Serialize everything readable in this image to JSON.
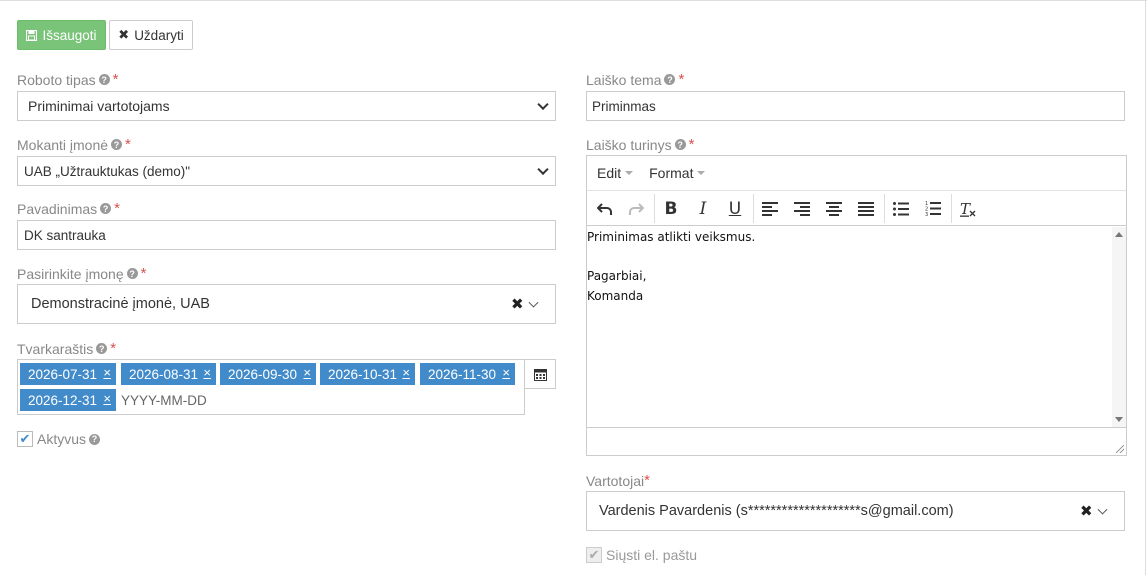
{
  "toolbar": {
    "save_label": "Išsaugoti",
    "close_label": "Uždaryti"
  },
  "form": {
    "robot_type": {
      "label": "Roboto tipas",
      "value": "Priminimai vartotojams"
    },
    "company": {
      "label": "Mokanti įmonė",
      "value": "UAB „Užtrauktukas (demo)\""
    },
    "name": {
      "label": "Pavadinimas",
      "value": "DK santrauka"
    },
    "select_company": {
      "label": "Pasirinkite įmonę",
      "value": "Demonstracinė įmonė, UAB"
    },
    "schedule": {
      "label": "Tvarkaraštis",
      "dates": [
        "2026-07-31",
        "2026-08-31",
        "2026-09-30",
        "2026-10-31",
        "2026-11-30",
        "2026-12-31"
      ],
      "remove_glyph": "×",
      "placeholder": "YYYY-MM-DD"
    },
    "active": {
      "label": "Aktyvus",
      "checked": true
    },
    "subject": {
      "label": "Laiško tema",
      "value": "Priminmas"
    },
    "body": {
      "label": "Laiško turinys",
      "menus": [
        "Edit",
        "Format"
      ],
      "lines": [
        "Priminimas atlikti veiksmus.",
        "",
        "Pagarbiai,",
        "Komanda"
      ]
    },
    "users": {
      "label": "Vartotojai",
      "value": "Vardenis Pavardenis (s********************s@gmail.com)"
    },
    "send_email": {
      "label": "Siųsti el. paštu",
      "checked": true
    }
  },
  "colors": {
    "save": "#5cb85c",
    "tag": "#428bca",
    "required": "#d9534f"
  }
}
